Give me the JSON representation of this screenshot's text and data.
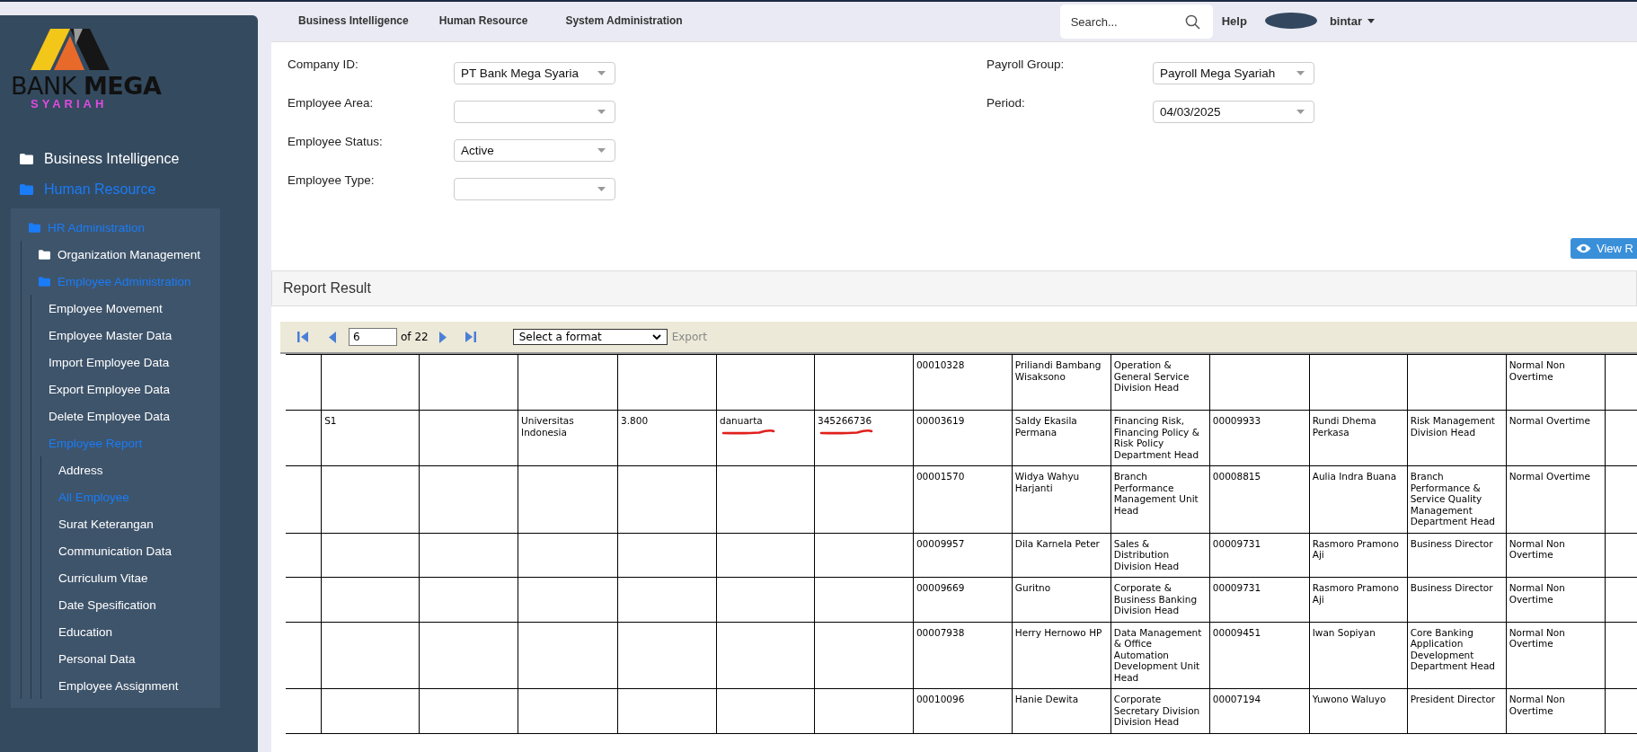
{
  "logo": {
    "line_1": "BANK **MEGA**",
    "line_2": "SYARIAH"
  },
  "sidebar": {
    "items": [
      {
        "label": "Business Intelligence",
        "kind": "folder",
        "expanded": false
      },
      {
        "label": "Human Resource",
        "kind": "folder",
        "expanded": true,
        "children": [
          {
            "label": "HR Administration",
            "kind": "folder",
            "expanded": true,
            "children": [
              {
                "label": "Organization Management",
                "kind": "folder",
                "expanded": false
              },
              {
                "label": "Employee Administration",
                "kind": "folder",
                "expanded": true,
                "children": [
                  {
                    "label": "Employee Movement",
                    "kind": "leaf",
                    "selected": false
                  },
                  {
                    "label": "Employee Master Data",
                    "kind": "leaf",
                    "selected": false
                  },
                  {
                    "label": "Import Employee Data",
                    "kind": "leaf",
                    "selected": false
                  },
                  {
                    "label": "Export Employee Data",
                    "kind": "leaf",
                    "selected": false
                  },
                  {
                    "label": "Delete Employee Data",
                    "kind": "leaf",
                    "selected": false
                  },
                  {
                    "label": "Employee Report",
                    "kind": "group",
                    "expanded": true,
                    "children": [
                      {
                        "label": "Address",
                        "kind": "leaf",
                        "selected": false
                      },
                      {
                        "label": "All Employee",
                        "kind": "leaf",
                        "selected": true
                      },
                      {
                        "label": "Surat Keterangan",
                        "kind": "leaf",
                        "selected": false
                      },
                      {
                        "label": "Communication Data",
                        "kind": "leaf",
                        "selected": false
                      },
                      {
                        "label": "Curriculum Vitae",
                        "kind": "leaf",
                        "selected": false
                      },
                      {
                        "label": "Date Spesification",
                        "kind": "leaf",
                        "selected": false
                      },
                      {
                        "label": "Education",
                        "kind": "leaf",
                        "selected": false
                      },
                      {
                        "label": "Personal Data",
                        "kind": "leaf",
                        "selected": false
                      },
                      {
                        "label": "Employee Assignment",
                        "kind": "leaf",
                        "selected": false
                      }
                    ]
                  }
                ]
              }
            ]
          }
        ]
      }
    ]
  },
  "top_nav": {
    "links": [
      "Business Intelligence",
      "Human Resource",
      "System Administration"
    ],
    "search": {
      "placeholder": "Search..."
    },
    "help": "Help",
    "user": "bintar"
  },
  "form": {
    "left": [
      {
        "label": "Company ID:",
        "value": "PT Bank Mega Syaria"
      },
      {
        "label": "Employee Area:"
      },
      {
        "label": "Employee Status:",
        "value": "Active"
      },
      {
        "label": "Employee Type:"
      }
    ],
    "right": [
      {
        "label": "Payroll Group:",
        "value": "Payroll Mega Syariah"
      },
      {
        "label": "Period:",
        "value": "04/03/2025"
      }
    ],
    "view_button": "View R"
  },
  "report": {
    "title": "Report Result",
    "page": "6",
    "page_total": "of 22",
    "format": {
      "placeholder": "Select a format"
    },
    "export": "Export",
    "rows": [
      [
        null,
        null,
        null,
        null,
        null,
        null,
        null,
        "00010328",
        "Priliandi Bambang Wisaksono",
        "Operation & General Service Division Head",
        null,
        null,
        null,
        "Normal Non Overtime",
        null
      ],
      [
        null,
        "S1",
        null,
        "Universitas Indonesia",
        "3.800",
        {
          "text": "danuarta",
          "underlined": true
        },
        {
          "text": "345266736",
          "underlined": true
        },
        "00003619",
        "Saldy Ekasila Permana",
        "Financing Risk, Financing Policy & Risk Policy Department Head",
        "00009933",
        "Rundi Dhema Perkasa",
        "Risk Management Division Head",
        "Normal Overtime",
        null
      ],
      [
        null,
        null,
        null,
        null,
        null,
        null,
        null,
        "00001570",
        "Widya Wahyu Harjanti",
        "Branch Performance Management Unit Head",
        "00008815",
        "Aulia Indra Buana",
        "Branch Performance & Service Quality Management Department Head",
        "Normal Overtime",
        null
      ],
      [
        null,
        null,
        null,
        null,
        null,
        null,
        null,
        "00009957",
        "Dila Karnela Peter",
        "Sales & Distribution Division Head",
        "00009731",
        "Rasmoro Pramono Aji",
        "Business Director",
        "Normal Non Overtime",
        null
      ],
      [
        null,
        null,
        null,
        null,
        null,
        null,
        null,
        "00009669",
        "Guritno",
        "Corporate & Business Banking Division Head",
        "00009731",
        "Rasmoro Pramono Aji",
        "Business Director",
        "Normal Non Overtime",
        null
      ],
      [
        null,
        null,
        null,
        null,
        null,
        null,
        null,
        "00007938",
        "Herry Hernowo HP",
        "Data Management & Office Automation Development Unit Head",
        "00009451",
        "Iwan Sopiyan",
        "Core Banking Application Development Department Head",
        "Normal Non Overtime",
        null
      ],
      [
        null,
        null,
        null,
        null,
        null,
        null,
        null,
        "00010096",
        "Hanie Dewita",
        "Corporate Secretary Division Division Head",
        "00007194",
        "Yuwono Waluyo",
        "President Director",
        "Normal Non Overtime",
        null
      ]
    ]
  }
}
